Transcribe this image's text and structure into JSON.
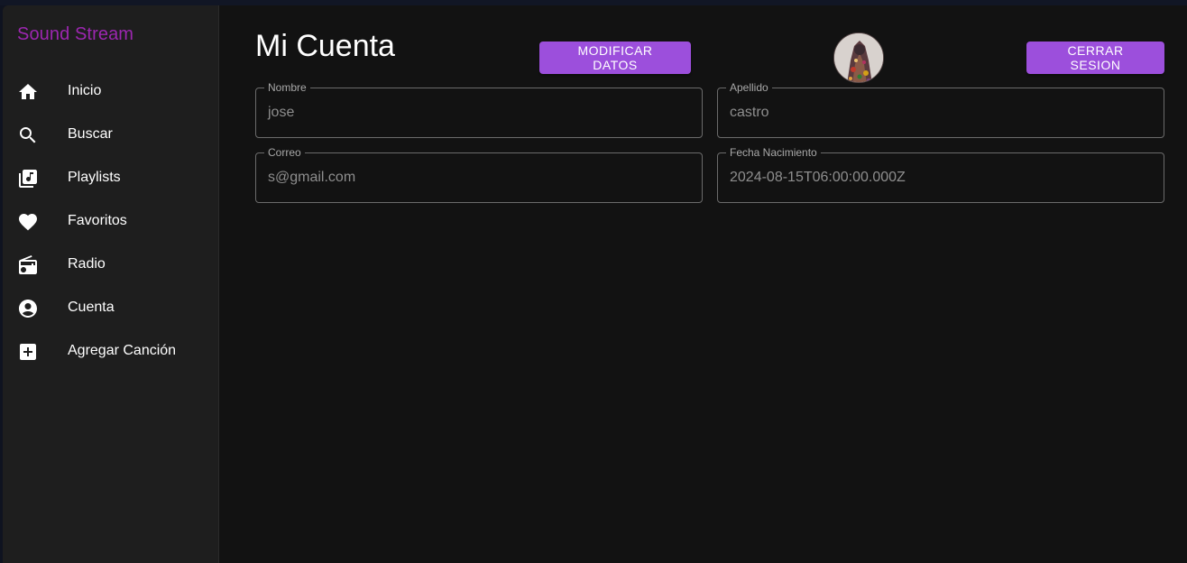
{
  "app": {
    "brand": "Sound Stream"
  },
  "sidebar": {
    "items": [
      {
        "label": "Inicio",
        "icon": "home-icon"
      },
      {
        "label": "Buscar",
        "icon": "search-icon"
      },
      {
        "label": "Playlists",
        "icon": "library-music-icon"
      },
      {
        "label": "Favoritos",
        "icon": "heart-icon"
      },
      {
        "label": "Radio",
        "icon": "radio-icon"
      },
      {
        "label": "Cuenta",
        "icon": "account-circle-icon"
      },
      {
        "label": "Agregar Canción",
        "icon": "add-box-icon"
      }
    ]
  },
  "main": {
    "title": "Mi Cuenta",
    "modify_button": "MODIFICAR DATOS",
    "logout_button": "CERRAR SESION",
    "fields": {
      "nombre": {
        "label": "Nombre",
        "value": "jose"
      },
      "apellido": {
        "label": "Apellido",
        "value": "castro"
      },
      "correo": {
        "label": "Correo",
        "value": "s@gmail.com"
      },
      "fecha": {
        "label": "Fecha Nacimiento",
        "value": "2024-08-15T06:00:00.000Z"
      }
    }
  },
  "colors": {
    "accent": "#9c4fdc",
    "brand": "#9c27b0",
    "background": "#121212",
    "sidebar": "#1e1e1e"
  }
}
